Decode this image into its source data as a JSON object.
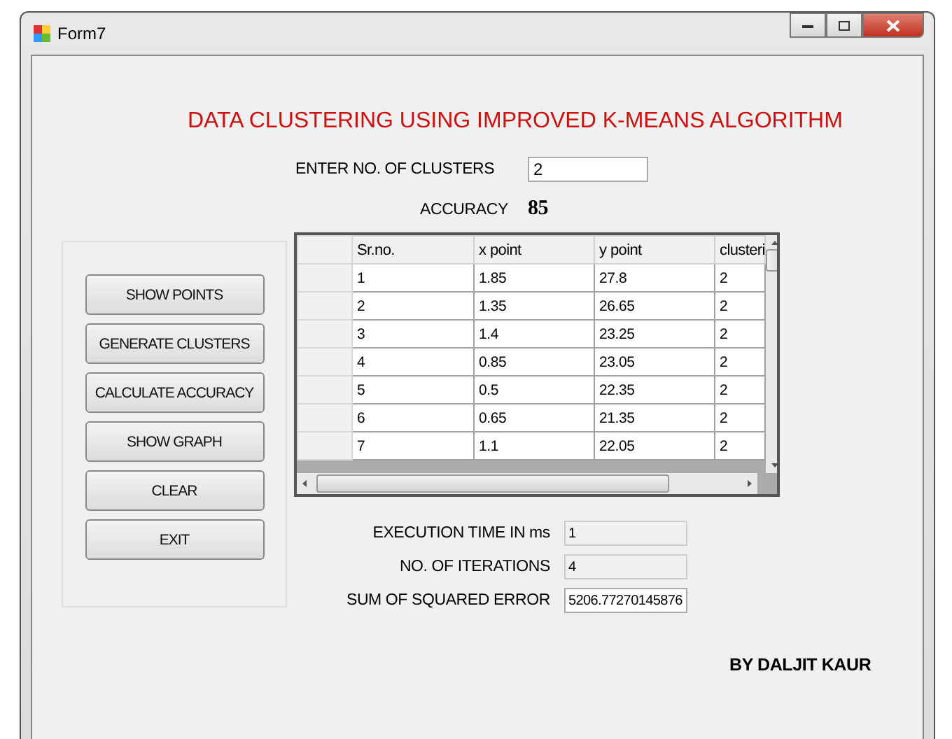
{
  "window": {
    "title": "Form7"
  },
  "heading": "DATA CLUSTERING USING IMPROVED K-MEANS ALGORITHM",
  "clusters": {
    "label": "ENTER NO. OF CLUSTERS",
    "value": "2"
  },
  "accuracy": {
    "label": "ACCURACY",
    "value": "85"
  },
  "buttons": [
    "SHOW POINTS",
    "GENERATE CLUSTERS",
    "CALCULATE ACCURACY",
    "SHOW GRAPH",
    "CLEAR",
    "EXIT"
  ],
  "table": {
    "columns": [
      "Sr.no.",
      "x point",
      "y point",
      "clusteri"
    ],
    "rows": [
      [
        "1",
        "1.85",
        "27.8",
        "2"
      ],
      [
        "2",
        "1.35",
        "26.65",
        "2"
      ],
      [
        "3",
        "1.4",
        "23.25",
        "2"
      ],
      [
        "4",
        "0.85",
        "23.05",
        "2"
      ],
      [
        "5",
        "0.5",
        "22.35",
        "2"
      ],
      [
        "6",
        "0.65",
        "21.35",
        "2"
      ],
      [
        "7",
        "1.1",
        "22.05",
        "2"
      ]
    ]
  },
  "results": [
    {
      "label": "EXECUTION TIME IN ms",
      "value": "1",
      "readonly": true
    },
    {
      "label": "NO. OF ITERATIONS",
      "value": "4",
      "readonly": true
    },
    {
      "label": "SUM OF SQUARED ERROR",
      "value": "5206.77270145876",
      "readonly": false
    }
  ],
  "author": "BY DALJIT KAUR"
}
